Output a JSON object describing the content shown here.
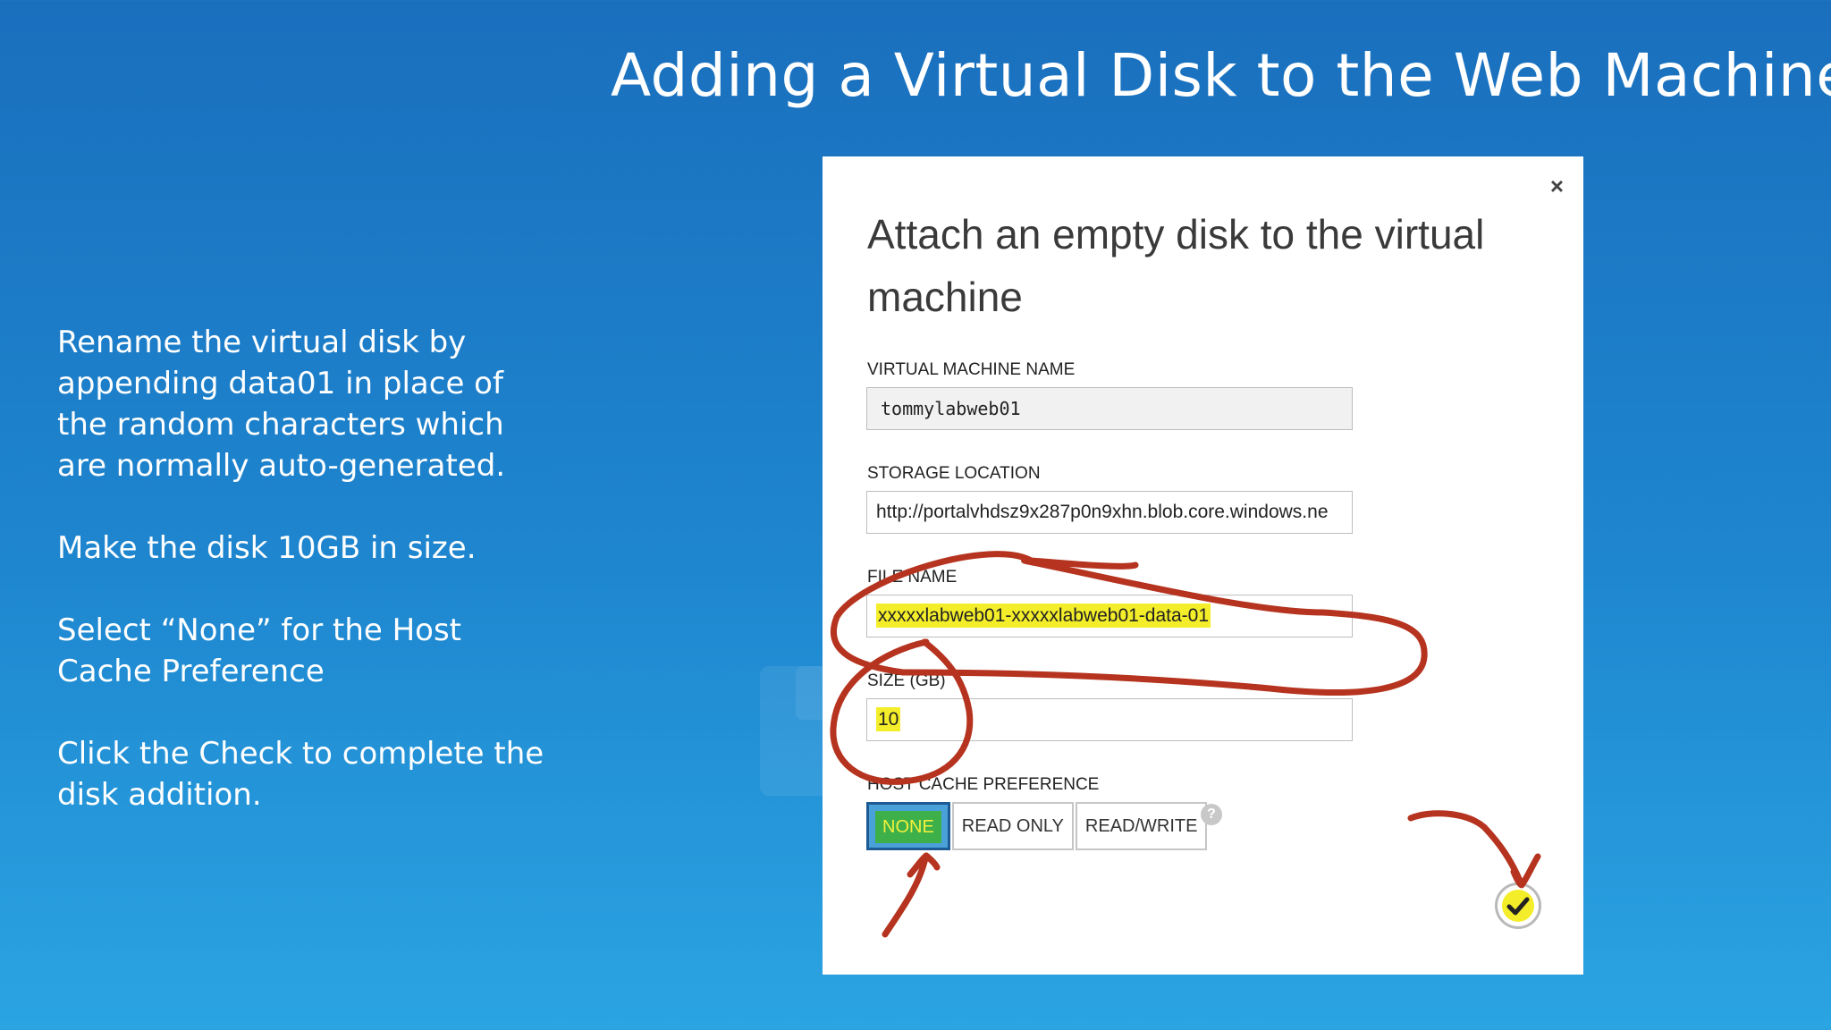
{
  "slide": {
    "title": "Adding a Virtual Disk to the Web Machine",
    "notes": [
      "Rename the virtual disk by appending data01 in place of the random characters which are normally auto-generated.",
      "Make the disk 10GB in size.",
      "Select “None” for the Host Cache Preference",
      "Click the Check to complete the disk addition."
    ]
  },
  "dialog": {
    "close_glyph": "×",
    "title": "Attach an empty disk to the virtual machine",
    "vm_name": {
      "label": "VIRTUAL MACHINE NAME",
      "value": "tommylabweb01"
    },
    "storage_location": {
      "label": "STORAGE LOCATION",
      "value": "http://portalvhdsz9x287p0n9xhn.blob.core.windows.ne"
    },
    "file_name": {
      "label": "FILE NAME",
      "value": "xxxxxlabweb01-xxxxxlabweb01-data-01"
    },
    "size": {
      "label": "SIZE (GB)",
      "value": "10"
    },
    "host_cache": {
      "label": "HOST CACHE PREFERENCE",
      "options": [
        "NONE",
        "READ ONLY",
        "READ/WRITE"
      ],
      "selected": "NONE",
      "help_glyph": "?"
    },
    "check_glyph": "✓",
    "colors": {
      "highlight": "#f4ee2a",
      "annotation": "#b5331f",
      "selected": "#4aa0d8"
    }
  }
}
